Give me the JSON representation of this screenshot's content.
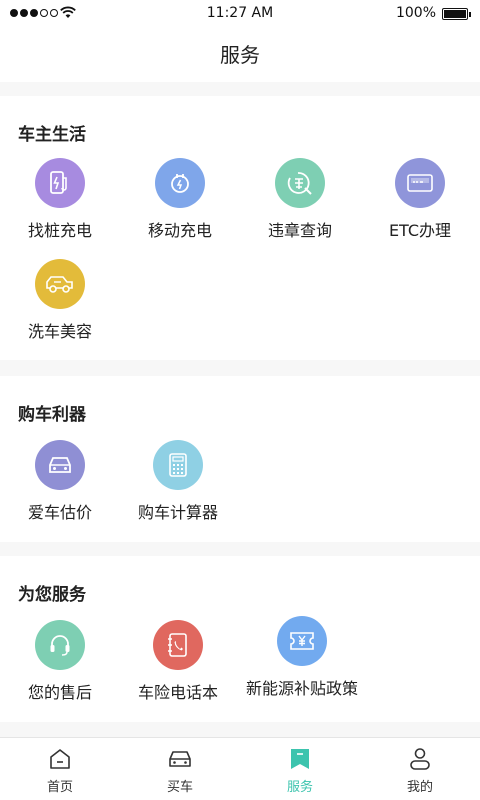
{
  "status_bar": {
    "time": "11:27 AM",
    "battery": "100%"
  },
  "header": {
    "title": "服务"
  },
  "sections": [
    {
      "title": "车主生活",
      "items": [
        {
          "label": "找桩充电",
          "icon": "charging-pile-icon",
          "color": "#a78be0"
        },
        {
          "label": "移动充电",
          "icon": "mobile-charge-icon",
          "color": "#7fa6ea"
        },
        {
          "label": "违章查询",
          "icon": "violation-query-icon",
          "color": "#7ecfb3"
        },
        {
          "label": "ETC办理",
          "icon": "etc-card-icon",
          "color": "#8f95da"
        },
        {
          "label": "洗车美容",
          "icon": "car-wash-icon",
          "color": "#e3bb3a"
        }
      ]
    },
    {
      "title": "购车利器",
      "items": [
        {
          "label": "爱车估价",
          "icon": "car-valuation-icon",
          "color": "#8f8fd4"
        },
        {
          "label": "购车计算器",
          "icon": "calculator-icon",
          "color": "#8fd0e4"
        }
      ]
    },
    {
      "title": "为您服务",
      "items": [
        {
          "label": "您的售后",
          "icon": "headset-icon",
          "color": "#7ecfb3"
        },
        {
          "label": "车险电话本",
          "icon": "phone-book-icon",
          "color": "#e0685f"
        },
        {
          "label": "新能源补贴政策",
          "icon": "subsidy-ticket-icon",
          "color": "#72aaef"
        }
      ]
    }
  ],
  "tabs": [
    {
      "label": "首页",
      "icon": "home-icon",
      "active": false
    },
    {
      "label": "买车",
      "icon": "car-icon",
      "active": false
    },
    {
      "label": "服务",
      "icon": "bookmark-icon",
      "active": true
    },
    {
      "label": "我的",
      "icon": "user-icon",
      "active": false
    }
  ],
  "colors": {
    "accent": "#3cc4ae",
    "background": "#f7f7f7"
  }
}
